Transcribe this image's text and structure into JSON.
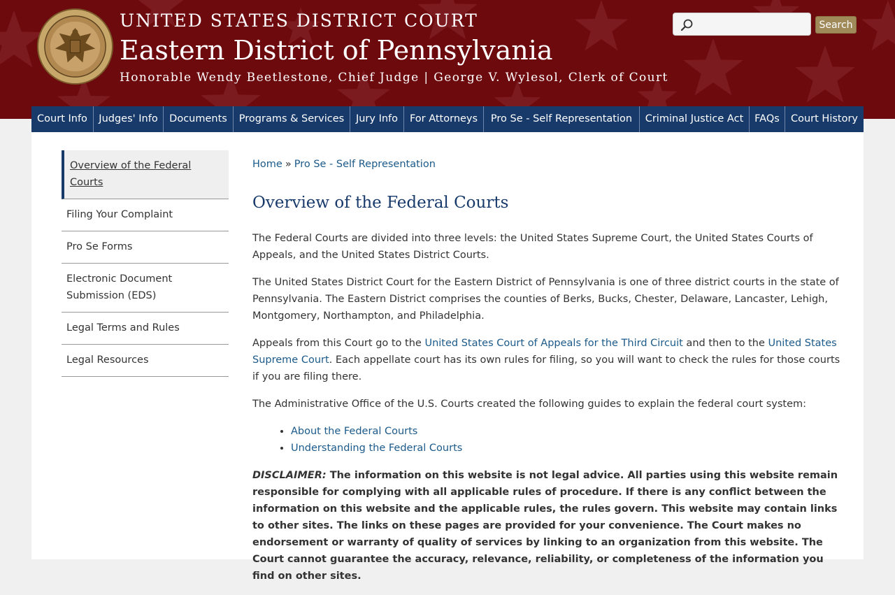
{
  "header": {
    "court_name": "UNITED STATES DISTRICT COURT",
    "district": "Eastern District of Pennsylvania",
    "officials": "Honorable Wendy Beetlestone, Chief Judge | George V. Wylesol, Clerk of Court",
    "seal_alt": "seal-icon"
  },
  "search": {
    "placeholder": "",
    "button_label": "Search"
  },
  "nav": {
    "items": [
      {
        "label": "Court Info"
      },
      {
        "label": "Judges' Info"
      },
      {
        "label": "Documents"
      },
      {
        "label": "Programs & Services"
      },
      {
        "label": "Jury Info"
      },
      {
        "label": "For Attorneys"
      },
      {
        "label": "Pro Se - Self Representation"
      },
      {
        "label": "Criminal Justice Act"
      },
      {
        "label": "FAQs"
      },
      {
        "label": "Court History"
      }
    ]
  },
  "sidebar": {
    "items": [
      {
        "label": "Overview of the Federal Courts",
        "active": true
      },
      {
        "label": "Filing Your Complaint"
      },
      {
        "label": "Pro Se Forms"
      },
      {
        "label": "Electronic Document Submission (EDS)"
      },
      {
        "label": "Legal Terms and Rules"
      },
      {
        "label": "Legal Resources"
      }
    ]
  },
  "breadcrumb": {
    "home": "Home",
    "separator": "»",
    "current": "Pro Se - Self Representation"
  },
  "main": {
    "title": "Overview of the Federal Courts",
    "p1": "The Federal Courts are divided into three levels: the United States Supreme Court, the United States Courts of Appeals, and the United States District Courts.",
    "p2": "The United States District Court for the Eastern District of Pennsylvania is one of three district courts in the state of Pennsylvania. The Eastern District comprises the counties of Berks, Bucks, Chester, Delaware, Lancaster, Lehigh, Montgomery, Northampton, and Philadelphia.",
    "p3_start": "Appeals from this Court go to the ",
    "p3_link1": "United States Court of Appeals for the Third Circuit",
    "p3_mid": " and then to the ",
    "p3_link2": "United States Supreme Court",
    "p3_end": ". Each appellate court has its own rules for filing, so you will want to check the rules for those courts if you are filing there.",
    "p4": "The Administrative Office of the U.S. Courts created the following guides to explain the federal court system:",
    "guides": [
      "About the Federal Courts",
      "Understanding the Federal Courts"
    ],
    "disclaimer_label": "DISCLAIMER:",
    "disclaimer_text": " The information on this website is not legal advice. All parties using this website remain responsible for complying with all applicable rules of procedure. If there is any conflict between the information on this website and the applicable rules, the rules govern. This website may contain links to other sites. The links on these pages are provided for your convenience. The Court makes no endorsement or warranty of quality of services by linking to an organization from this website. The Court cannot guarantee the accuracy, relevance, reliability, or completeness of the information you find on other sites."
  },
  "colors": {
    "header_bg": "#6d0a0e",
    "nav_bg": "#173a6b",
    "link": "#1b5a8a",
    "search_button": "#a08a5a"
  }
}
